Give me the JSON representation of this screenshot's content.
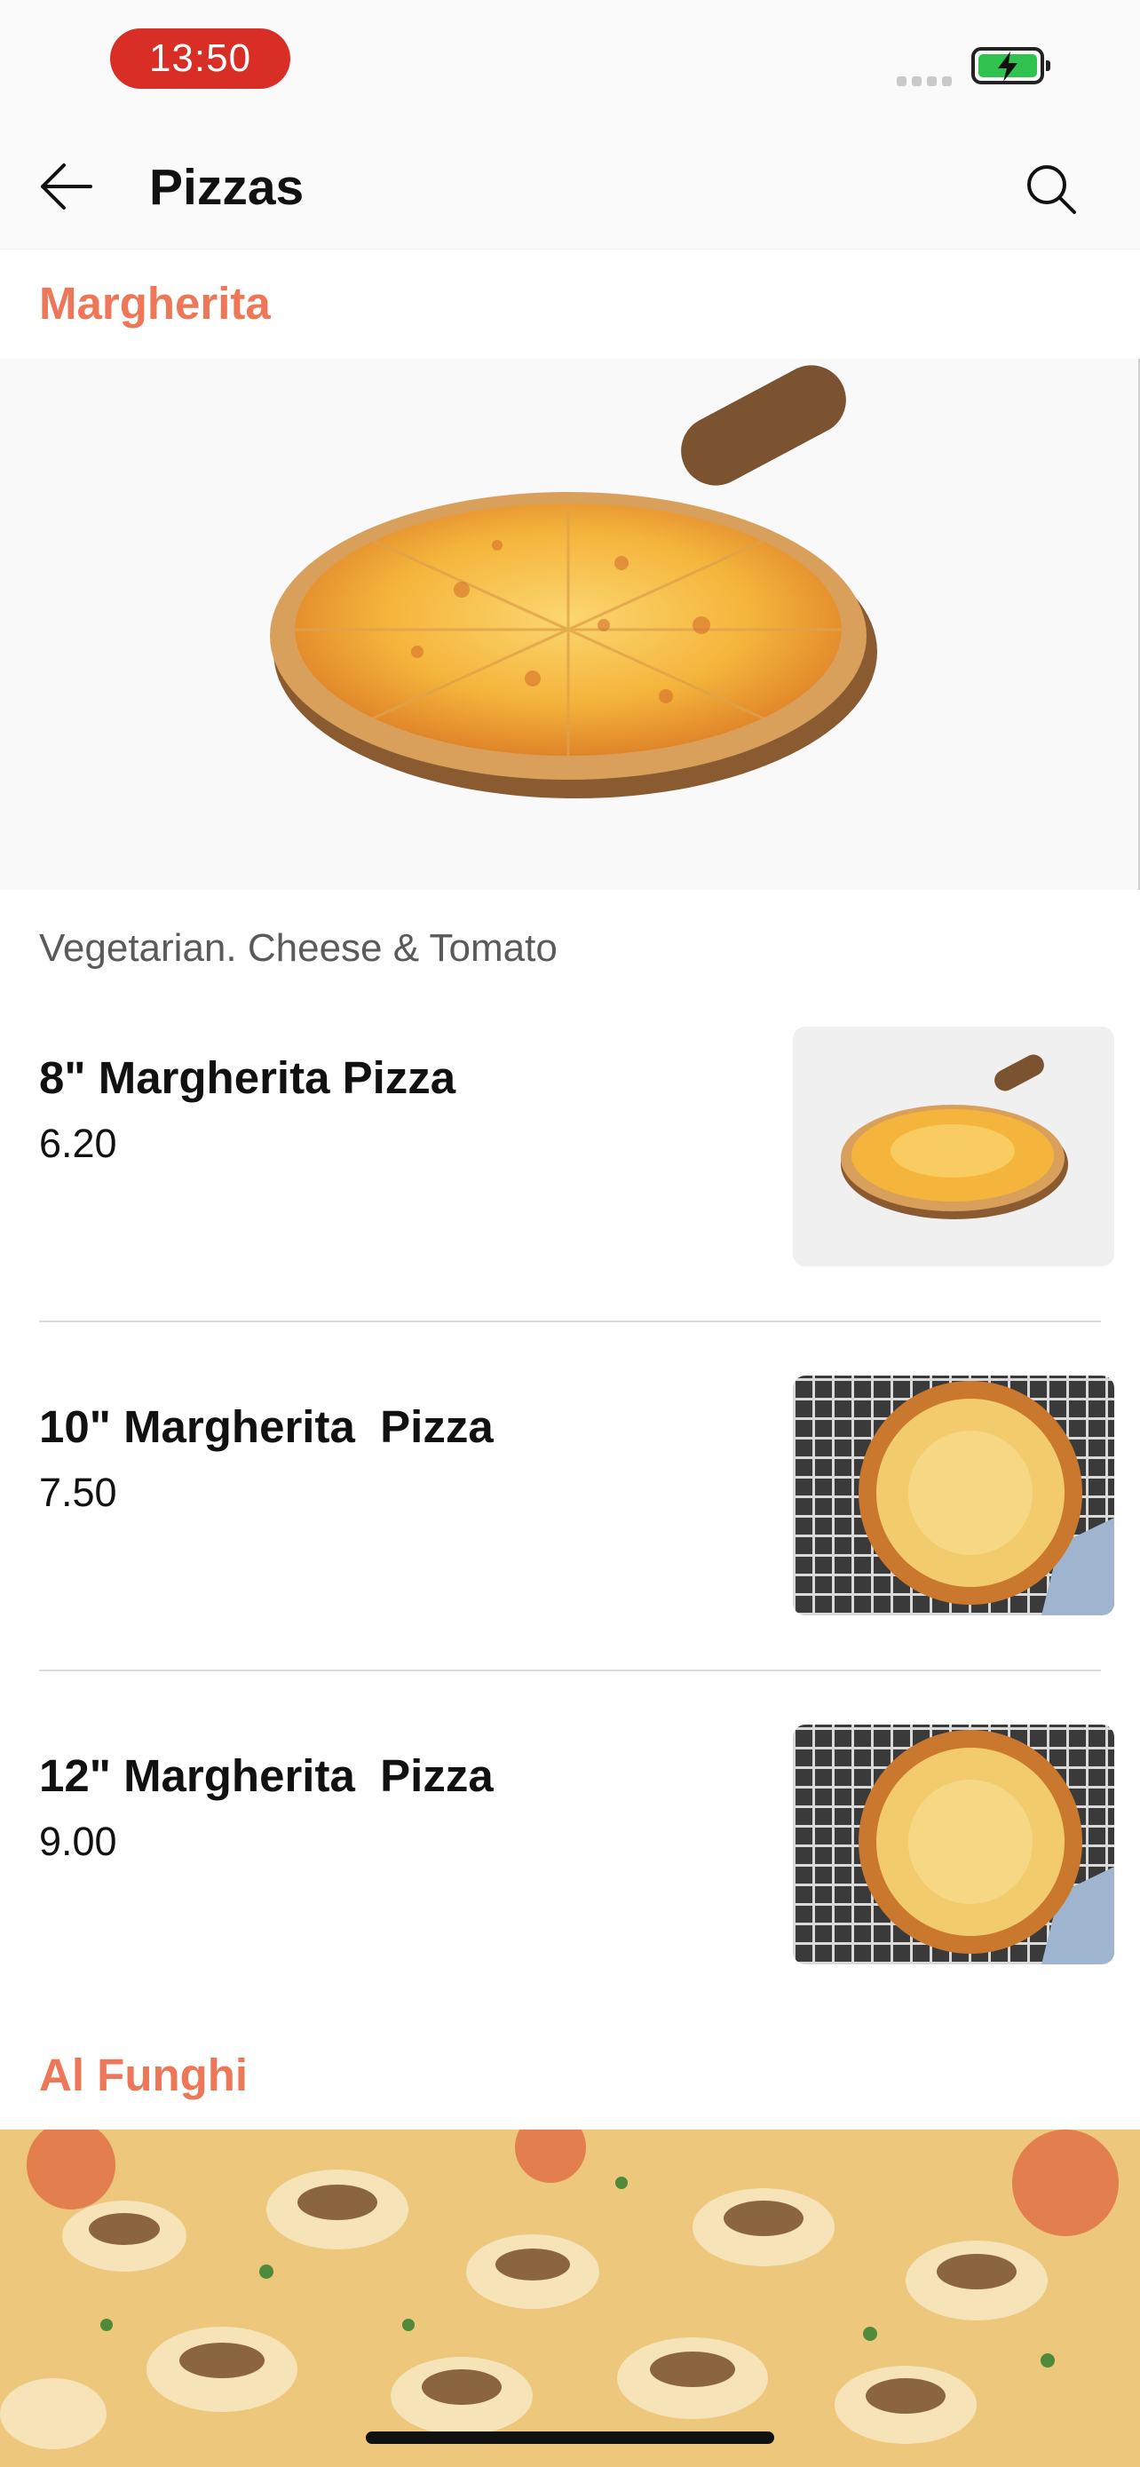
{
  "status_bar": {
    "time": "13:50",
    "battery_color": "#2fc24f",
    "time_pill_color": "#d92e26"
  },
  "header": {
    "title": "Pizzas",
    "back_icon": "arrow-left-icon",
    "search_icon": "search-icon"
  },
  "accent_color": "#ee7758",
  "categories": [
    {
      "name": "Margherita",
      "description": "Vegetarian. Cheese & Tomato",
      "items": [
        {
          "name": "8\" Margherita Pizza",
          "price": "6.20"
        },
        {
          "name": "10\" Margherita  Pizza",
          "price": "7.50"
        },
        {
          "name": "12\" Margherita  Pizza",
          "price": "9.00"
        }
      ]
    },
    {
      "name": "Al Funghi"
    }
  ]
}
